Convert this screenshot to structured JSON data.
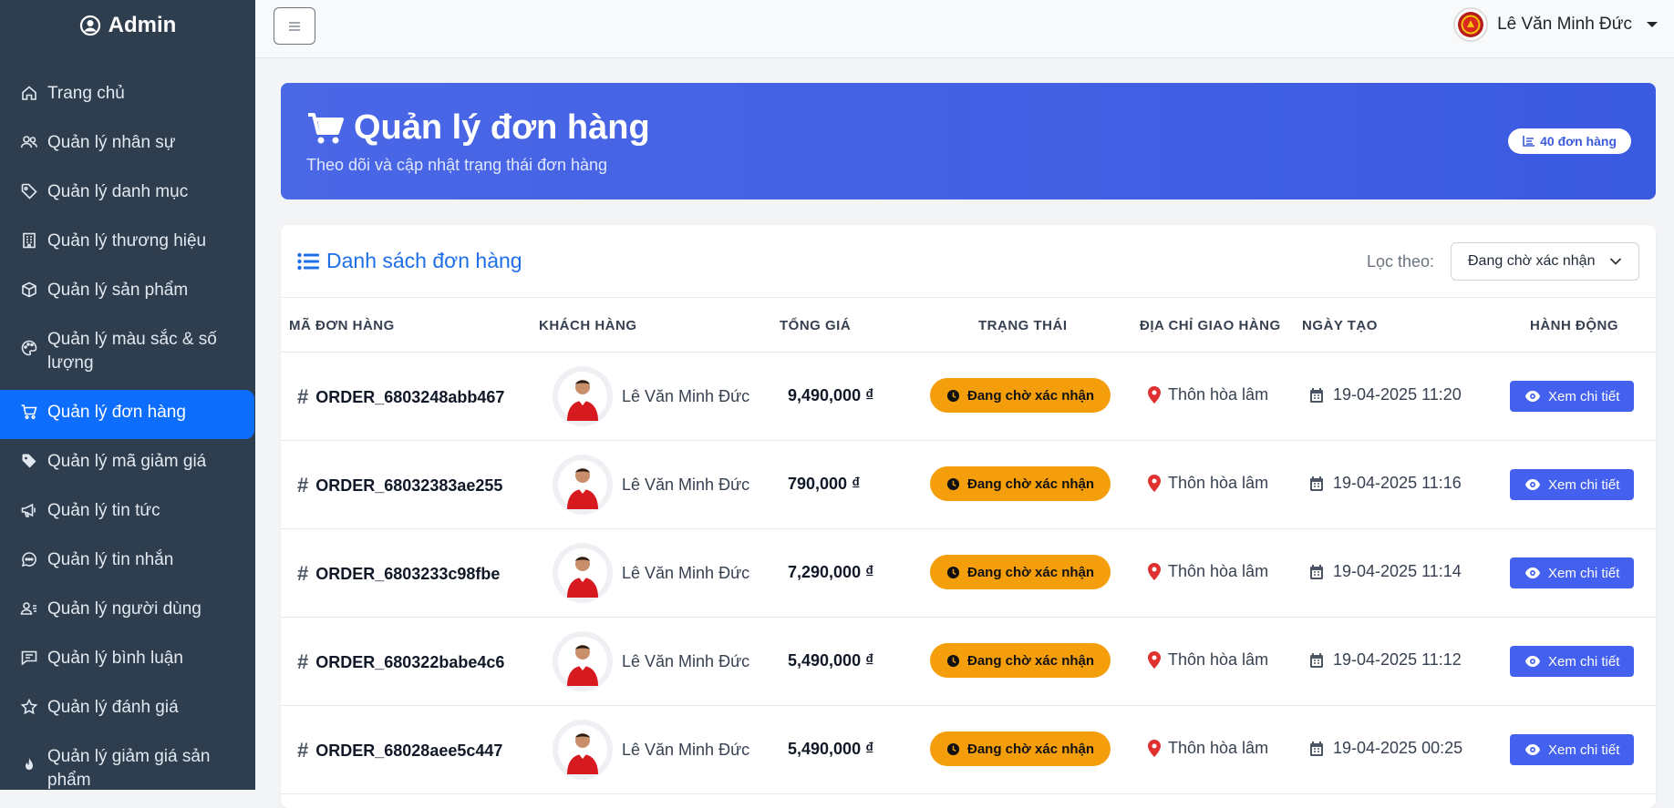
{
  "sidebar": {
    "brand": "Admin",
    "items": [
      {
        "label": "Trang chủ",
        "icon": "home-icon"
      },
      {
        "label": "Quản lý nhân sự",
        "icon": "users-icon"
      },
      {
        "label": "Quản lý danh mục",
        "icon": "tag-icon"
      },
      {
        "label": "Quản lý thương hiệu",
        "icon": "building-icon"
      },
      {
        "label": "Quản lý sản phẩm",
        "icon": "box-icon"
      },
      {
        "label": "Quản lý màu sắc & số lượng",
        "icon": "palette-icon"
      },
      {
        "label": "Quản lý đơn hàng",
        "icon": "cart-icon",
        "active": true
      },
      {
        "label": "Quản lý mã giảm giá",
        "icon": "tag-fill-icon"
      },
      {
        "label": "Quản lý tin tức",
        "icon": "megaphone-icon"
      },
      {
        "label": "Quản lý tin nhắn",
        "icon": "chat-icon"
      },
      {
        "label": "Quản lý người dùng",
        "icon": "user-lines-icon"
      },
      {
        "label": "Quản lý bình luận",
        "icon": "comment-icon"
      },
      {
        "label": "Quản lý đánh giá",
        "icon": "star-icon"
      },
      {
        "label": "Quản lý giảm giá sản phẩm",
        "icon": "fire-icon"
      }
    ]
  },
  "topbar": {
    "toggle_icon": "hamburger-icon",
    "user_name": "Lê Văn Minh Đức"
  },
  "hero": {
    "title": "Quản lý đơn hàng",
    "subtitle": "Theo dõi và cập nhật trạng thái đơn hàng",
    "count_label": "40 đơn hàng"
  },
  "list": {
    "title": "Danh sách đơn hàng",
    "filter_label": "Lọc theo:",
    "filter_value": "Đang chờ xác nhận",
    "columns": [
      "MÃ ĐƠN HÀNG",
      "KHÁCH HÀNG",
      "TỔNG GIÁ",
      "TRẠNG THÁI",
      "ĐỊA CHỈ GIAO HÀNG",
      "NGÀY TẠO",
      "HÀNH ĐỘNG"
    ],
    "rows": [
      {
        "id": "ORDER_6803248abb467",
        "customer": "Lê Văn Minh Đức",
        "total": "9,490,000 ₫",
        "status": "Đang chờ xác nhận",
        "address": "Thôn hòa lâm",
        "date": "19-04-2025 11:20",
        "action": "Xem chi tiết"
      },
      {
        "id": "ORDER_68032383ae255",
        "customer": "Lê Văn Minh Đức",
        "total": "790,000 ₫",
        "status": "Đang chờ xác nhận",
        "address": "Thôn hòa lâm",
        "date": "19-04-2025 11:16",
        "action": "Xem chi tiết"
      },
      {
        "id": "ORDER_6803233c98fbe",
        "customer": "Lê Văn Minh Đức",
        "total": "7,290,000 ₫",
        "status": "Đang chờ xác nhận",
        "address": "Thôn hòa lâm",
        "date": "19-04-2025 11:14",
        "action": "Xem chi tiết"
      },
      {
        "id": "ORDER_680322babe4c6",
        "customer": "Lê Văn Minh Đức",
        "total": "5,490,000 ₫",
        "status": "Đang chờ xác nhận",
        "address": "Thôn hòa lâm",
        "date": "19-04-2025 11:12",
        "action": "Xem chi tiết"
      },
      {
        "id": "ORDER_68028aee5c447",
        "customer": "Lê Văn Minh Đức",
        "total": "5,490,000 ₫",
        "status": "Đang chờ xác nhận",
        "address": "Thôn hòa lâm",
        "date": "19-04-2025 00:25",
        "action": "Xem chi tiết"
      }
    ]
  },
  "colors": {
    "sidebar_bg": "#2f3e4e",
    "active_item": "#0d6efd",
    "hero_bg": "#4361ee",
    "status_pending": "#f59e0b",
    "action_button": "#4361ee"
  }
}
